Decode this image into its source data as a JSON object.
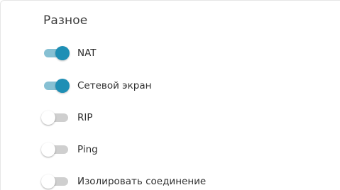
{
  "section": {
    "title": "Разное"
  },
  "toggles": [
    {
      "label": "NAT",
      "checked": true
    },
    {
      "label": "Сетевой экран",
      "checked": true
    },
    {
      "label": "RIP",
      "checked": false
    },
    {
      "label": "Ping",
      "checked": false
    },
    {
      "label": "Изолировать соединение",
      "checked": false
    }
  ],
  "colors": {
    "toggle_on_knob": "#1e8fb5",
    "toggle_on_track": "#86c0d3",
    "toggle_off_track": "#cfcfcf",
    "toggle_off_knob": "#ffffff"
  }
}
